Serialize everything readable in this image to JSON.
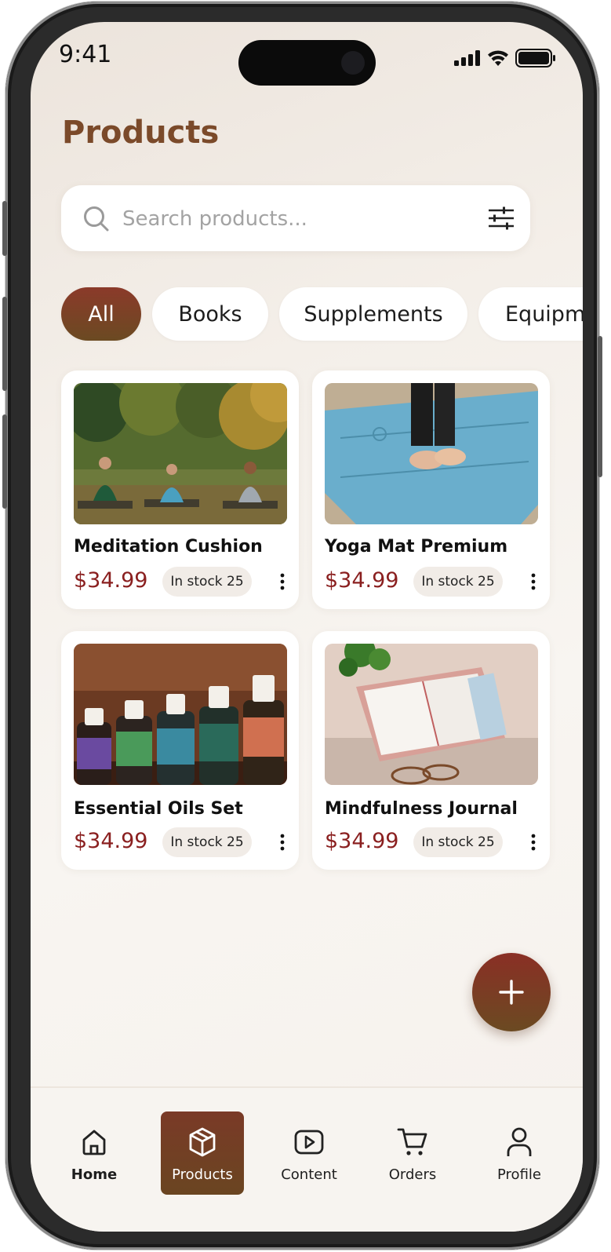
{
  "status": {
    "time": "9:41"
  },
  "header": {
    "title": "Products"
  },
  "search": {
    "placeholder": "Search products..."
  },
  "categories": [
    {
      "label": "All",
      "active": true
    },
    {
      "label": "Books",
      "active": false
    },
    {
      "label": "Supplements",
      "active": false
    },
    {
      "label": "Equipm",
      "active": false
    }
  ],
  "products": [
    {
      "name": "Meditation Cushion",
      "price": "$34.99",
      "stock": "In stock 25",
      "image": "outdoor-meditation-group-photo"
    },
    {
      "name": "Yoga Mat Premium",
      "price": "$34.99",
      "stock": "In stock 25",
      "image": "blue-yoga-mat-photo"
    },
    {
      "name": "Essential Oils Set",
      "price": "$34.99",
      "stock": "In stock 25",
      "image": "essential-oil-bottles-photo"
    },
    {
      "name": "Mindfulness Journal",
      "price": "$34.99",
      "stock": "In stock 25",
      "image": "open-journal-photo"
    }
  ],
  "nav": [
    {
      "label": "Home",
      "icon": "home-icon",
      "active": false
    },
    {
      "label": "Products",
      "icon": "box-icon",
      "active": true
    },
    {
      "label": "Content",
      "icon": "play-icon",
      "active": false
    },
    {
      "label": "Orders",
      "icon": "cart-icon",
      "active": false
    },
    {
      "label": "Profile",
      "icon": "user-icon",
      "active": false
    }
  ],
  "colors": {
    "accent": "#7b4a2a",
    "price": "#8a1f1f",
    "active_gradient_top": "#8b3a2a",
    "active_gradient_bottom": "#6b4a22"
  }
}
